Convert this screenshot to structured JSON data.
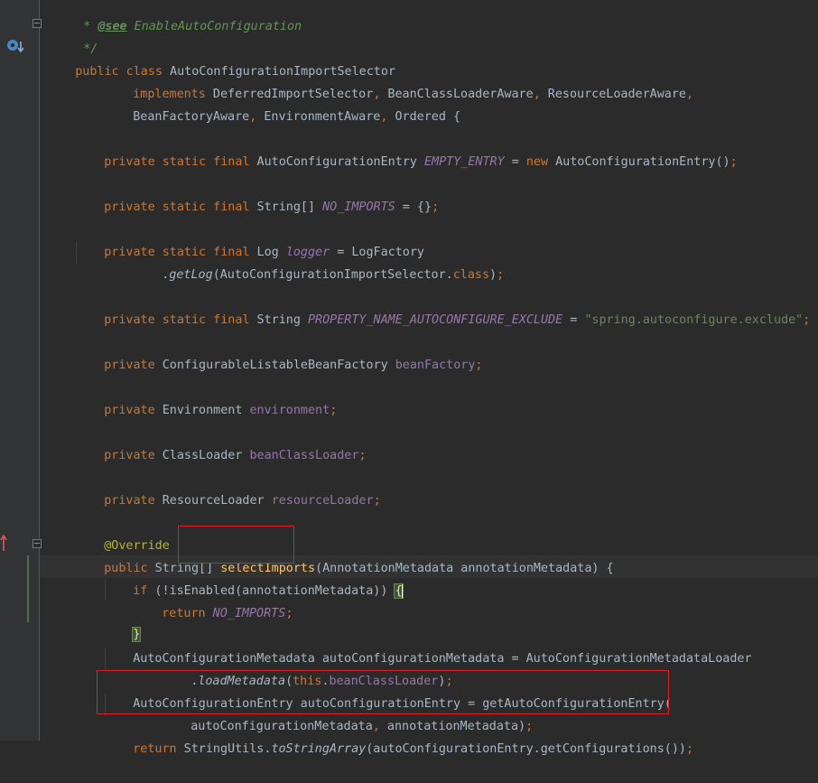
{
  "editor": {
    "gutter_icons": {
      "implements_marker": "implementation-marker-icon",
      "override_marker": "override-marker-icon"
    },
    "lines": {
      "l0_prefix": "* ",
      "l0_tag": "@see",
      "l0_rest": " EnableAutoConfiguration",
      "l1": "*/",
      "l2_kw": "public class",
      "l2_name": " AutoConfigurationImportSelector",
      "l3_kw": "implements",
      "l3_rest_a": " DeferredImportSelector",
      "l3_comma1": ",",
      "l3_rest_b": " BeanClassLoaderAware",
      "l3_comma2": ",",
      "l3_rest_c": " ResourceLoaderAware",
      "l3_comma3": ",",
      "l4_a": "BeanFactoryAware",
      "l4_comma1": ",",
      "l4_b": " EnvironmentAware",
      "l4_comma2": ",",
      "l4_c": " Ordered {",
      "l6_kw": "private static final",
      "l6_type": " AutoConfigurationEntry ",
      "l6_field": "EMPTY_ENTRY",
      "l6_eq": " = ",
      "l6_new": "new",
      "l6_rest": " AutoConfigurationEntry()",
      "l6_semi": ";",
      "l8_kw": "private static final",
      "l8_type": " String[] ",
      "l8_field": "NO_IMPORTS",
      "l8_rest": " = {}",
      "l8_semi": ";",
      "l10_kw": "private static final",
      "l10_type": " Log ",
      "l10_field": "logger",
      "l10_rest": " = LogFactory",
      "l11_dot": ".",
      "l11_method": "getLog",
      "l11_rest": "(AutoConfigurationImportSelector.",
      "l11_class": "class",
      "l11_end": ")",
      "l11_semi": ";",
      "l13_kw": "private static final",
      "l13_type": " String ",
      "l13_field": "PROPERTY_NAME_AUTOCONFIGURE_EXCLUDE",
      "l13_eq": " = ",
      "l13_str": "\"spring.autoconfigure.exclude\"",
      "l13_semi": ";",
      "l15_kw": "private",
      "l15_type": " ConfigurableListableBeanFactory ",
      "l15_field": "beanFactory",
      "l15_semi": ";",
      "l17_kw": "private",
      "l17_type": " Environment ",
      "l17_field": "environment",
      "l17_semi": ";",
      "l19_kw": "private",
      "l19_type": " ClassLoader ",
      "l19_field": "beanClassLoader",
      "l19_semi": ";",
      "l21_kw": "private",
      "l21_type": " ResourceLoader ",
      "l21_field": "resourceLoader",
      "l21_semi": ";",
      "l23_ann": "@Override",
      "l24_kw": "public",
      "l24_type": " String[] ",
      "l24_method": "selectImports",
      "l24_rest": "(AnnotationMetadata annotationMetadata) {",
      "l25_if": "if",
      "l25_rest": " (!isEnabled(annotationMetadata)) ",
      "l25_brace": "{",
      "l26_ret": "return",
      "l26_field": " NO_IMPORTS",
      "l26_semi": ";",
      "l27_brace": "}",
      "l28": "AutoConfigurationMetadata autoConfigurationMetadata = AutoConfigurationMetadataLoader",
      "l29_dot": ".",
      "l29_method": "loadMetadata",
      "l29_open": "(",
      "l29_this": "this",
      "l29_dot2": ".",
      "l29_field": "beanClassLoader",
      "l29_end": ")",
      "l29_semi": ";",
      "l30": "AutoConfigurationEntry autoConfigurationEntry = getAutoConfigurationEntry(",
      "l31_a": "autoConfigurationMetadata",
      "l31_comma": ",",
      "l31_b": " annotationMetadata)",
      "l31_semi": ";",
      "l32_ret": "return",
      "l32_a": " StringUtils.",
      "l32_method": "toStringArray",
      "l32_b": "(autoConfigurationEntry.getConfigurations())",
      "l32_semi": ";"
    }
  },
  "colors": {
    "background": "#2b2b2b",
    "keyword": "#cc7832",
    "field": "#9876aa",
    "string": "#6a8759",
    "annotation": "#bbb529",
    "highlight_box": "#e02020"
  }
}
